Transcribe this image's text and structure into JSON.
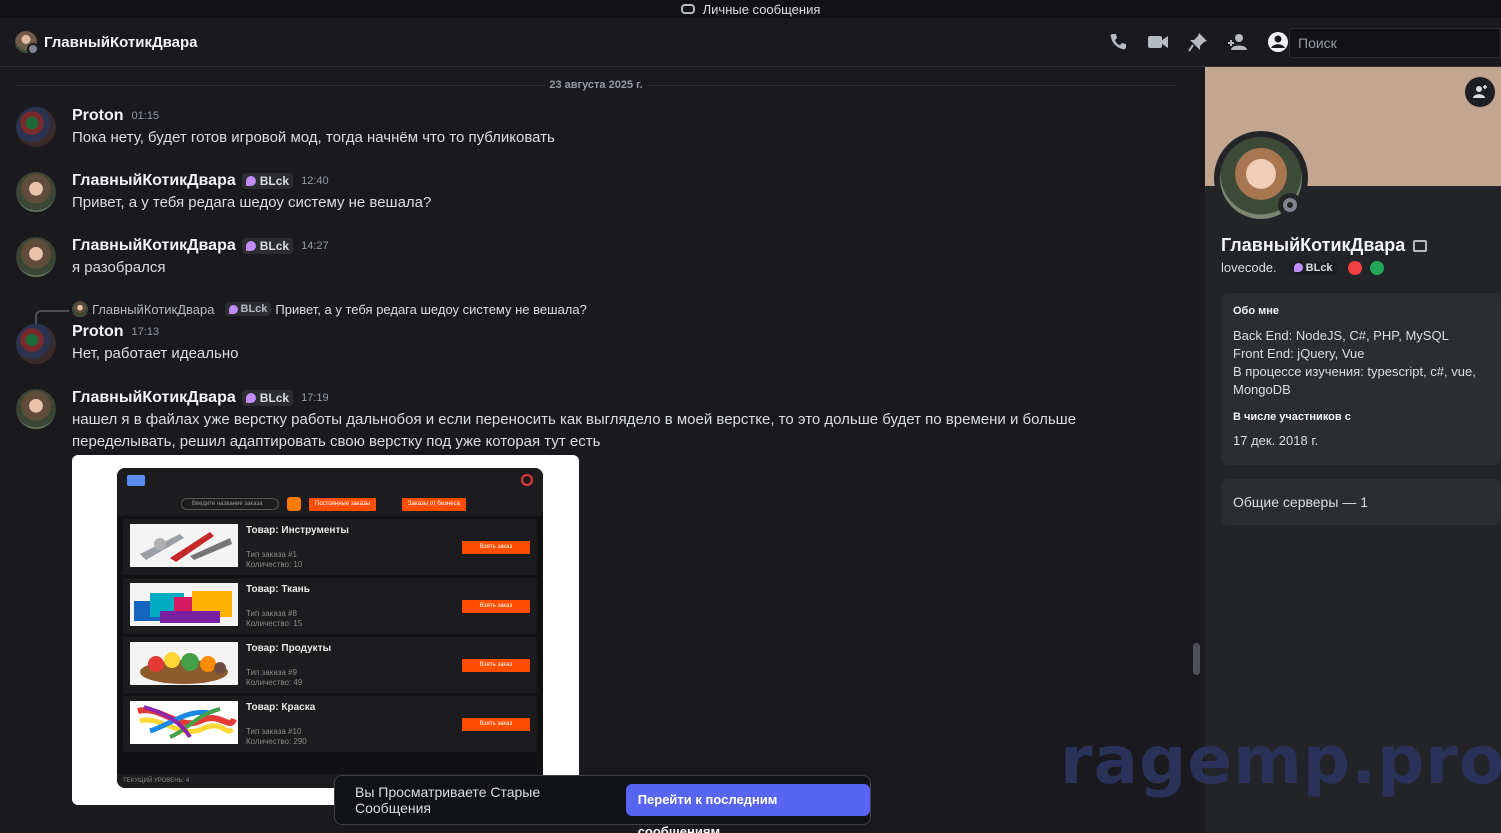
{
  "window": {
    "title": "Личные сообщения"
  },
  "header": {
    "name": "ГлавныйКотикДвара",
    "search_placeholder": "Поиск"
  },
  "chat": {
    "date": "23 августа 2025 г.",
    "messages": [
      {
        "author": "Proton",
        "time": "01:15",
        "text": "Пока нету, будет готов игровой мод, тогда начнём что то публиковать"
      },
      {
        "author": "ГлавныйКотикДвара",
        "tag": "BLck",
        "time": "12:40",
        "text": "Привет, а у тебя редага шедоу систему не вешала?"
      },
      {
        "author": "ГлавныйКотикДвара",
        "tag": "BLck",
        "time": "14:27",
        "text": "я разобрался"
      },
      {
        "author": "Proton",
        "time": "17:13",
        "text": "Нет, работает идеально",
        "reply": {
          "author": "ГлавныйКотикДвара",
          "tag": "BLck",
          "text": "Привет, а у тебя редага шедоу систему не вешала?"
        }
      },
      {
        "author": "ГлавныйКотикДвара",
        "tag": "BLck",
        "time": "17:19",
        "text": "нашел я в файлах уже верстку работы дальнобоя и если переносить как выглядело в моей верстке, то это дольше будет по времени и больше переделывать, решил адаптировать свою верстку под уже которая тут есть"
      }
    ],
    "attachment": {
      "search_placeholder": "Введите название заказа",
      "btn_permanent": "Постоянные заказы",
      "btn_business": "Заказы от бизнеса",
      "take_label": "Взять заказ",
      "footer": "ТЕКУЩИЙ УРОВЕНЬ: 4",
      "items": [
        {
          "title": "Товар: Инструменты",
          "type": "Тип заказа #1",
          "qty": "Количество: 10"
        },
        {
          "title": "Товар: Ткань",
          "type": "Тип заказа #8",
          "qty": "Количество: 15"
        },
        {
          "title": "Товар: Продукты",
          "type": "Тип заказа #9",
          "qty": "Количество: 49"
        },
        {
          "title": "Товар: Краска",
          "type": "Тип заказа #10",
          "qty": "Количество: 290"
        }
      ]
    }
  },
  "profile": {
    "name": "ГлавныйКотикДвара",
    "username": "lovecode.",
    "tag": "BLck",
    "about_title": "Обо мне",
    "about_lines": [
      "Back End: NodeJS, C#, PHP, MySQL",
      "Front End: jQuery, Vue",
      "В процессе изучения: typescript, c#, vue, MongoDB"
    ],
    "member_since_title": "В числе участников с",
    "member_since": "17 дек. 2018 г.",
    "mutual_servers": "Общие серверы — 1"
  },
  "old_messages_bar": {
    "text": "Вы Просматриваете Старые Сообщения",
    "button": "Перейти к последним сообщениям"
  },
  "watermark": "ragemp.pro",
  "colors": {
    "accent": "#5865f2",
    "orange": "#ff4e00",
    "background": "#1a1a1e"
  }
}
